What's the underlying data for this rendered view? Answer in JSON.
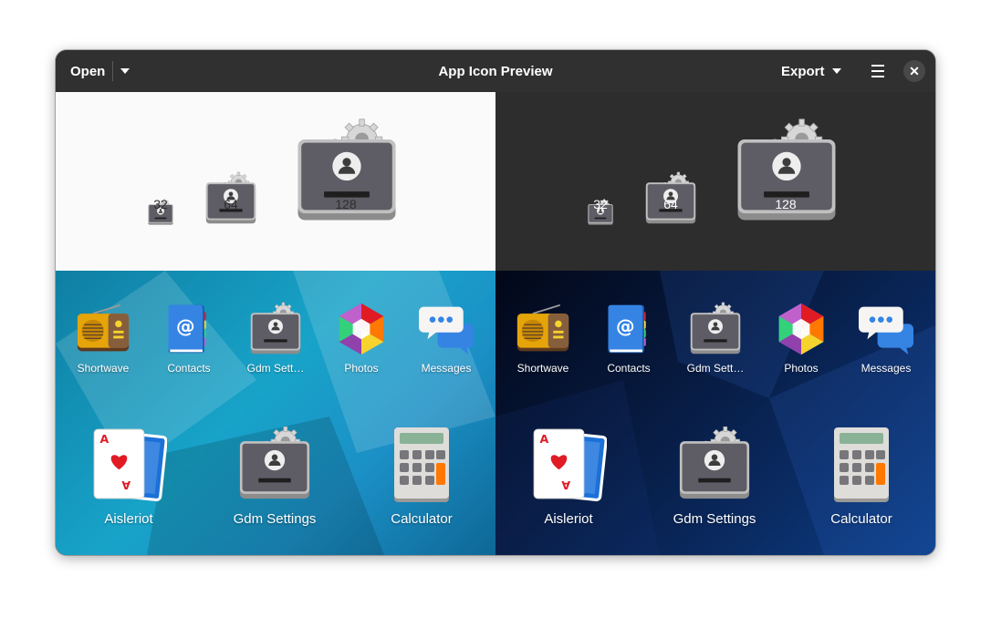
{
  "header": {
    "open_label": "Open",
    "title": "App Icon Preview",
    "export_label": "Export",
    "close_glyph": "✕"
  },
  "preview_sizes": [
    "32",
    "64",
    "128"
  ],
  "small_apps": [
    "Shortwave",
    "Contacts",
    "Gdm Sett…",
    "Photos",
    "Messages"
  ],
  "large_apps": [
    "Aisleriot",
    "Gdm Settings",
    "Calculator"
  ],
  "icons": {
    "open_dropdown": "chevron-down-icon",
    "export_dropdown": "chevron-down-icon",
    "menu": "hamburger-menu-icon",
    "close": "close-icon"
  },
  "colors": {
    "headerbar": "#303030",
    "light_bg": "#fafafa",
    "dark_bg": "#2d2d2d",
    "teal_grid": "#18a3c9",
    "navy_grid": "#071a3f"
  }
}
